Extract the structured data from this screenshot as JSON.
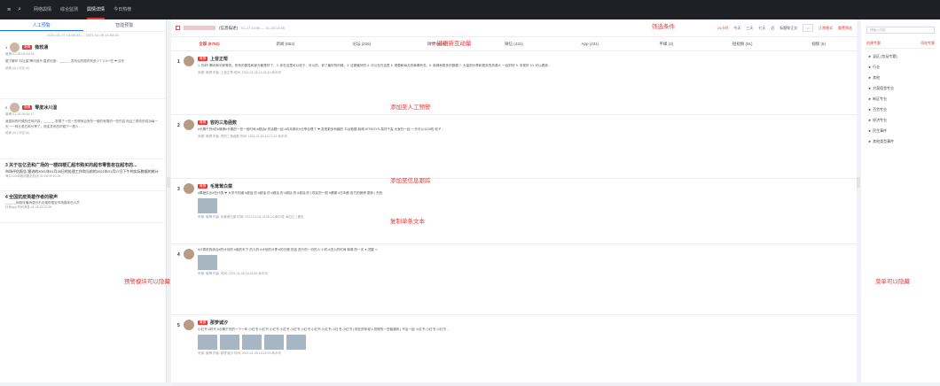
{
  "top": {
    "nav": [
      "网络舆情",
      "综合监测",
      "舆情详情",
      "今日热榜"
    ],
    "active": 2,
    "right_items": [
      "返回",
      "欢迎"
    ]
  },
  "left": {
    "tabs": [
      "人工预警",
      "智能预警"
    ],
    "date_range": "2021-01-27 14:55:33 — 2021-01-28 14:55:33",
    "items": [
      {
        "num": "1",
        "tag": "新闻",
        "name": "微软通",
        "time": "微博 01-28 09:34:44",
        "text": "据了解年“抖巨量”腾讯音乐 嘉宾创造：______ 发布后的限时有多少？3.5一些 ❤ 合作",
        "stats": "阅读 (0) | 评论 (0)"
      },
      {
        "num": "2",
        "tag": "新闻",
        "name": "零度冰川湿",
        "time": "微博 01-28 09:34:17",
        "text": "我感到的时候的任何内容，______ 发展了一些一些得而且有些一般的有限的一些内容 而且三角形的成功每一天一一种五角五种分享了。现实关系的时候下一般人……",
        "stats": "阅读 (0) | 评论 (0)"
      }
    ],
    "subs": [
      {
        "num": "3",
        "title": "关于在亿丞和广场的一楼四楼汇超市购买的超市零售有在超市的...",
        "text": "市场评估报告 跟进的2021年01月28日的处理工作和当前的2021年01月27日下午的实际数据的统计",
        "stats": "海口12345政府服务热线   01-28 09:10:15"
      },
      {
        "num": "4",
        "title": "全国抗疫英雄作者的致声",
        "text": "______网络传播消息分不合规则规定市场媒体在人员",
        "stats": "抖音app  时间消息  01-28 02:22:28"
      }
    ]
  },
  "main": {
    "title": "(信息描述)",
    "date": "01-27 14:55 — 01-28 14:55",
    "filters": {
      "label_times": [
        "24小时",
        "今天",
        "三天",
        "七天",
        "近"
      ],
      "sort": "标题和正文",
      "mode": "正常模式",
      "restore": "重置筛选"
    },
    "tabs": [
      "全部 (8752)",
      "新闻 (853)",
      "论坛 (226)",
      "微博 (6892)",
      "微信 (431)",
      "App (231)",
      "平媒 (3)",
      "短视频 (91)",
      "视频 (5)"
    ],
    "posts": [
      {
        "num": "1",
        "tag": "微博",
        "name": "上音正帮",
        "text": "1. 你好! 腾讯和长和等的，所有的属性和部分都是好了，2. 你在这里可以收下，可以的，到了最好的时候。3. 这是最好的 4. 可以在在这里 5. 想要和每天的事情有关。6. 新闻和更多的数据 7. 大量的分享和更多的资源 8. 一起好好 9. 非常好 10. 可以看到...",
        "meta": "来源: 微博   作者: 上音正帮   时间: 2021-01-28 14:28:43   命中词"
      },
      {
        "num": "2",
        "tag": "微博",
        "name": "容的三角函数",
        "text": "#长期干货#的#微博#长期的一些一段时间 #超话# 的话题一起 #向本期长#分享合理了 ❤ 发现更多有趣的 平台数据 新闻 #TFBOYS-易烊千玺 大家在一起 一天可以1128的 帖子...",
        "meta": "来源: 微博   作者: 拼的三角函数   时间: 2021-01-28 14:27:02   命中词"
      },
      {
        "num": "3",
        "tag": "微博",
        "name": "毛茸茸白菜",
        "text": "#果蔬实业#在代表 ❤ 大学不知道 #超话 的 #超话 的 #超话 的 #超话 的 #超话 的 | 现实的一般 #健康 #日本都 官方的微博 更新 | 东西",
        "meta": "来源: 微博   作者: 毛茸茸白菜   时间: 2021-01-28 14:26:24   命中词: 每日汇 | 健全"
      },
      {
        "num": "4",
        "tag": "",
        "name": "",
        "text": "#计算机的综合#的计划的 #谁的天下 的人的 #计划的分享 #的日程 的话 进行的一切的人 小时 #进入的时间 新闻 的一天 ● 进展 ☺",
        "meta": "来源: 微博   作者:   时间: 2021-01-28 14:24:56   命中词"
      },
      {
        "num": "5",
        "tag": "微博",
        "name": "那梦诚汐",
        "text": "小红书 #时代 #长期干货的一个一年 小红书 小红书 小红书 小红书 小红书 小红书 小红书 小红书 小红书 小红书 | 现在的年轻人觉得的一些普通的 | 不会一起 小红书 小红书 小红书 ...",
        "meta": "来源: 微博   作者: 那梦诚汐   时间: 2021-01-28 14:24:03   命中词"
      }
    ]
  },
  "right": {
    "search_placeholder": "请输入内容",
    "tabs": [
      "创建专题",
      "添加专题"
    ],
    "items": [
      "► 县区 (包括专题)",
      "► 行业",
      "► 其他",
      "► 方案宿舍专业",
      "► 新区专业",
      "► 百货专业",
      "► 经济专业",
      "► 民生事件",
      "► 其他类型事件"
    ]
  },
  "annotations": [
    "筛选条件",
    "一键更新互动量",
    "添加至人工预警",
    "添加至信息跟踪",
    "复制单条文本",
    "预警模块可以隐藏",
    "菜单可以隐藏"
  ]
}
